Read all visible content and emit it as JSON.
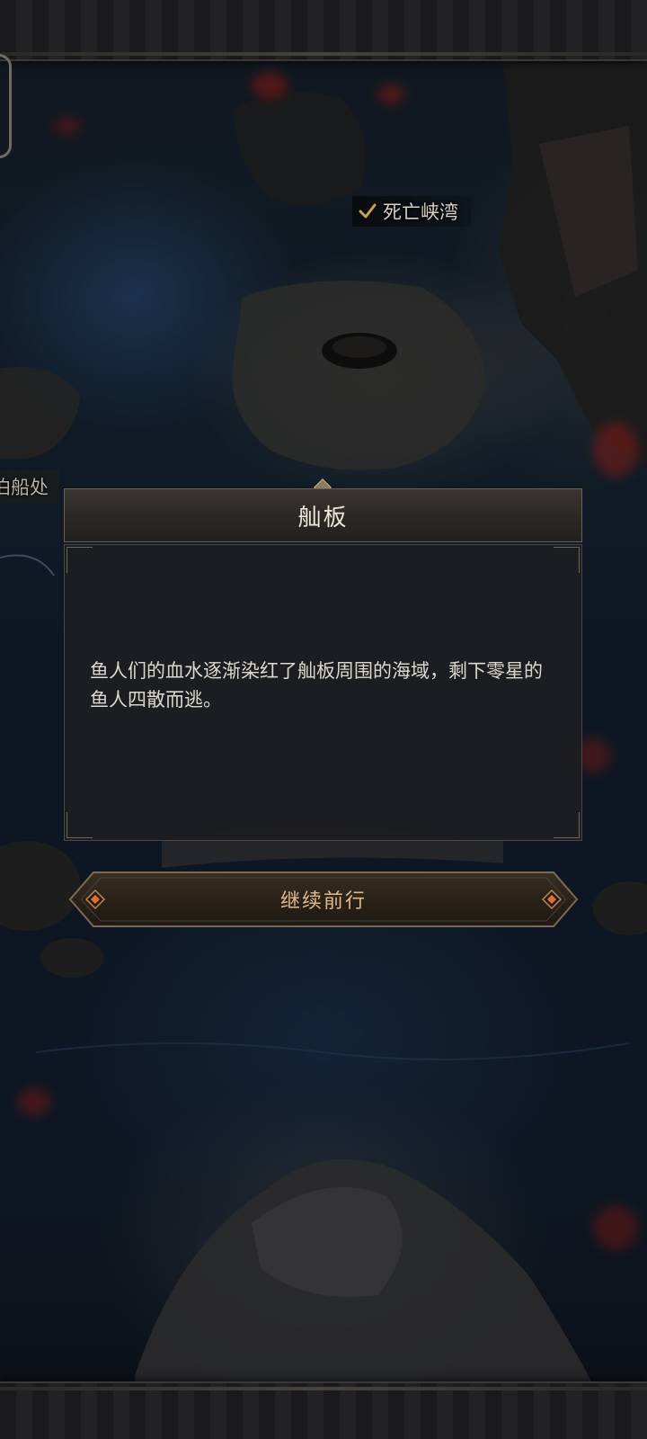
{
  "map": {
    "locations": [
      {
        "label": "死亡峡湾",
        "completed": true
      },
      {
        "label": "泊船处",
        "completed": false
      }
    ]
  },
  "dialog": {
    "title": "舢板",
    "text": "鱼人们的血水逐渐染红了舢板周围的海域，剩下零星的鱼人四散而逃。"
  },
  "actions": {
    "continue_label": "继续前行"
  },
  "colors": {
    "accent_gold": "#e0b88a",
    "ember_red": "#8a1b14",
    "sea_blue": "#1e3a58"
  }
}
